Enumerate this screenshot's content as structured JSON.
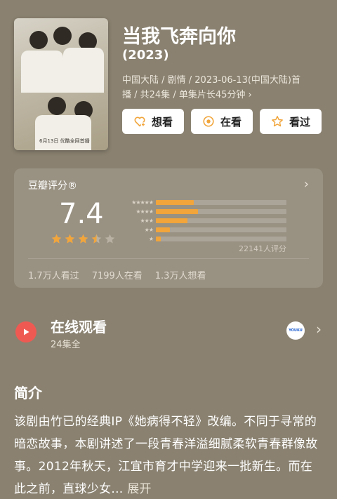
{
  "poster": {
    "caption": "6月13日 优酷全网首播"
  },
  "title": "当我飞奔向你",
  "year": "(2023)",
  "meta_line1": "中国大陆 / 剧情 / 2023-06-13(中国大陆)首",
  "meta_line2": "播 / 共24集 / 单集片长45分钟 ›",
  "actions": [
    {
      "label": "想看",
      "icon": "heart-plus-icon"
    },
    {
      "label": "在看",
      "icon": "target-icon"
    },
    {
      "label": "看过",
      "icon": "star-outline-icon"
    }
  ],
  "rating": {
    "label": "豆瓣评分®",
    "score": "7.4",
    "stars_value": 3.5,
    "distribution": [
      {
        "stars": "★★★★★",
        "percent": 29
      },
      {
        "stars": "★★★★",
        "percent": 32
      },
      {
        "stars": "★★★",
        "percent": 24
      },
      {
        "stars": "★★",
        "percent": 11
      },
      {
        "stars": "★",
        "percent": 4
      }
    ],
    "count": "22141人评分",
    "watched": "1.7万人看过",
    "watching": "7199人在看",
    "want": "1.3万人想看",
    "accent": "#f1a53b"
  },
  "watch": {
    "title": "在线观看",
    "episodes": "24集全",
    "platform_icon": "youku-icon",
    "platform_text": "YOUKU"
  },
  "intro": {
    "title": "简介",
    "text": "该剧由竹已的经典IP《她病得不轻》改编。不同于寻常的暗恋故事，本剧讲述了一段青春洋溢细腻柔软青春群像故事。2012年秋天，江宜市育才中学迎来一批新生。而在此之前，直球少女...",
    "expand": "展开"
  }
}
